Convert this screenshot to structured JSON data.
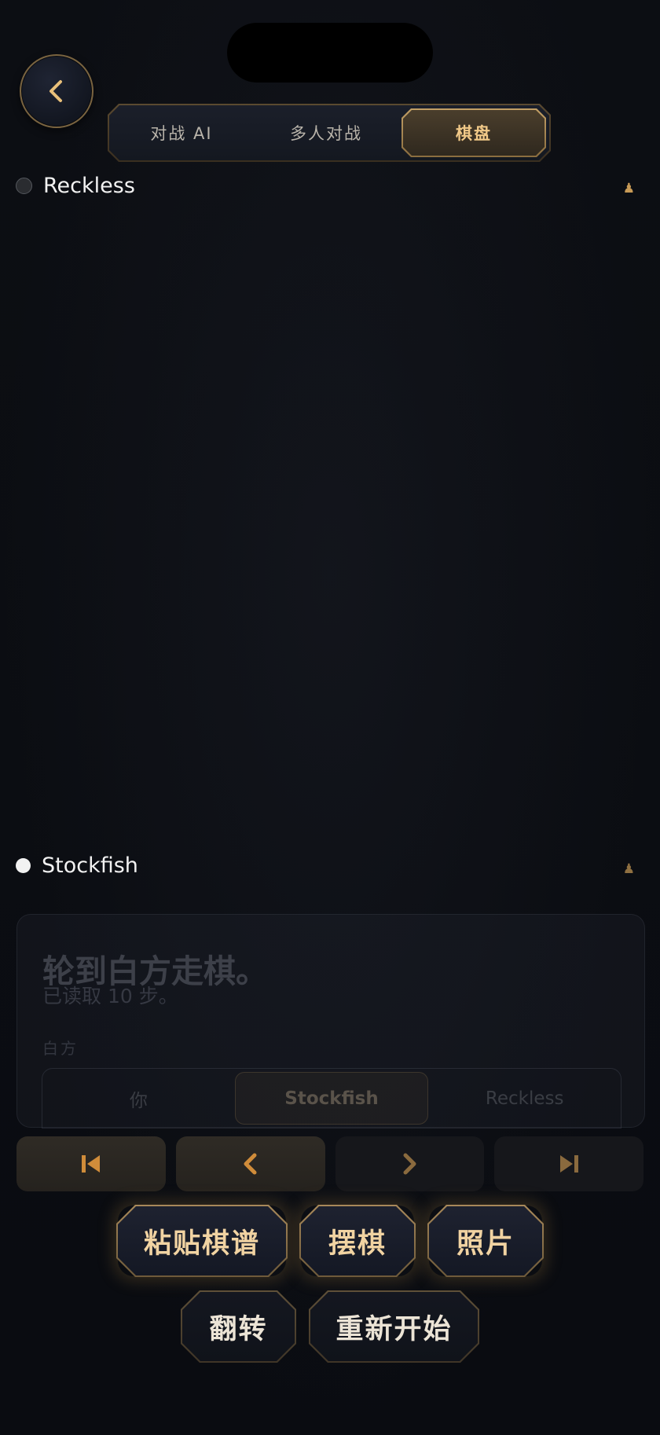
{
  "nav": {
    "back_icon": "chevron-left-icon"
  },
  "tabs": [
    {
      "label": "对战 AI",
      "active": false
    },
    {
      "label": "多人对战",
      "active": false
    },
    {
      "label": "棋盘",
      "active": true
    }
  ],
  "players": {
    "top": {
      "name": "Reckless",
      "color": "black",
      "piece_icon": "♟"
    },
    "bottom": {
      "name": "Stockfish",
      "color": "white",
      "piece_icon": "♟"
    }
  },
  "status": {
    "title": "轮到白方走棋。",
    "subtitle": "已读取 10 步。",
    "side_label": "白方",
    "side_options": [
      "你",
      "Stockfish",
      "Reckless"
    ],
    "selected_side": "Stockfish"
  },
  "move_nav": [
    {
      "name": "first-move-icon",
      "enabled": true
    },
    {
      "name": "prev-move-icon",
      "enabled": true
    },
    {
      "name": "next-move-icon",
      "enabled": false
    },
    {
      "name": "last-move-icon",
      "enabled": false
    }
  ],
  "actions": {
    "paste_pgn": "粘贴棋谱",
    "setup": "摆棋",
    "photo": "照片",
    "flip": "翻转",
    "restart": "重新开始"
  },
  "colors": {
    "accent": "#c9a066",
    "background": "#0b0d12"
  }
}
